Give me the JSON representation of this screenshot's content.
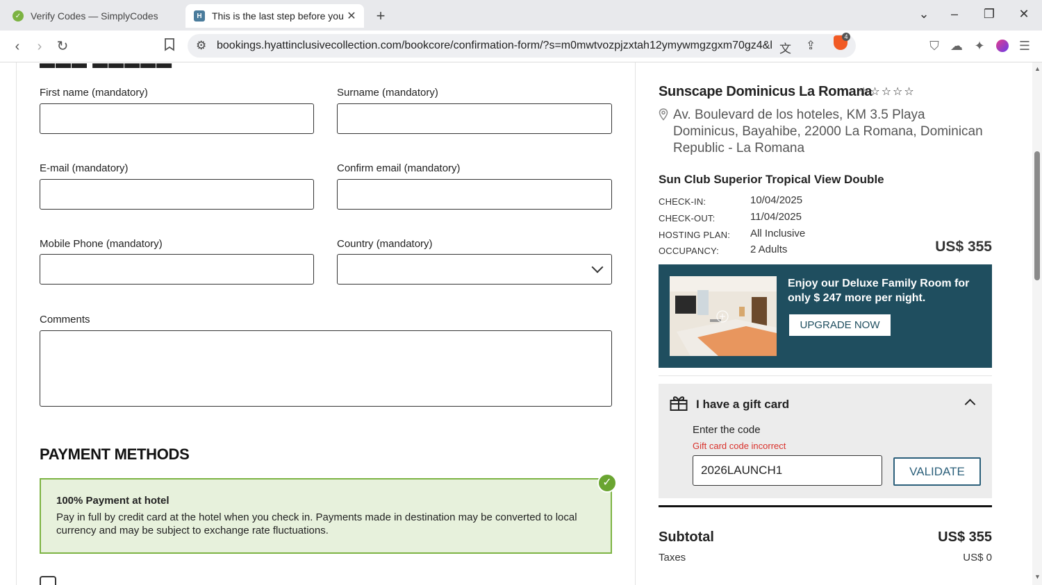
{
  "browser": {
    "tabs": [
      {
        "title": "Verify Codes — SimplyCodes",
        "favicon": "simplycodes-icon"
      },
      {
        "title": "This is the last step before your",
        "favicon": "hyatt-icon",
        "favicon_letter": "H"
      }
    ],
    "new_tab": "+",
    "url": "bookings.hyattinclusivecollection.com/bookcore/confirmation-form/?s=m0mwtvozpjzxtah12ymywmgzgxm70gz4&l...",
    "brave_badge": "4"
  },
  "guest_form": {
    "first_name_label": "First name (mandatory)",
    "surname_label": "Surname (mandatory)",
    "email_label": "E-mail (mandatory)",
    "confirm_email_label": "Confirm email (mandatory)",
    "phone_label": "Mobile Phone (mandatory)",
    "country_label": "Country (mandatory)",
    "comments_label": "Comments",
    "first_name_value": "",
    "surname_value": "",
    "email_value": "",
    "confirm_email_value": "",
    "phone_value": "",
    "country_value": ""
  },
  "payment": {
    "title": "PAYMENT METHODS",
    "option_title": "100% Payment at hotel",
    "option_desc": "Pay in full by credit card at the hotel when you check in. Payments made in destination may be converted to local currency and may be subject to exchange rate fluctuations.",
    "selected": true
  },
  "summary": {
    "hotel_name": "Sunscape Dominicus La Romana",
    "stars": "☆☆☆☆☆",
    "address": "Av. Boulevard de los hoteles, KM 3.5 Playa Dominicus, Bayahibe, 22000 La Romana, Dominican Republic - La Romana",
    "room_name": "Sun Club Superior Tropical View Double",
    "details": [
      {
        "key": "CHECK-IN:",
        "value": "10/04/2025"
      },
      {
        "key": "CHECK-OUT:",
        "value": "11/04/2025"
      },
      {
        "key": "HOSTING PLAN:",
        "value": "All Inclusive"
      },
      {
        "key": "OCCUPANCY:",
        "value": "2 Adults"
      }
    ],
    "price": "US$ 355",
    "upgrade_text": "Enjoy our Deluxe Family Room for only $ 247 more per night.",
    "upgrade_button": "UPGRADE NOW",
    "gift_title": "I have a gift card",
    "gift_label": "Enter the code",
    "gift_error": "Gift card code incorrect",
    "gift_code": "2026LAUNCH1",
    "validate_button": "VALIDATE",
    "subtotal_label": "Subtotal",
    "subtotal_value": "US$ 355",
    "taxes_label": "Taxes",
    "taxes_value": "US$ 0"
  },
  "colors": {
    "accent": "#1f4e5f",
    "success": "#7cb342",
    "error": "#d9302a"
  }
}
